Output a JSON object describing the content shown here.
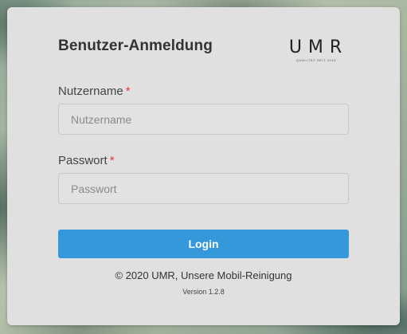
{
  "login": {
    "title": "Benutzer-Anmeldung",
    "logo": {
      "text": "UMR",
      "tagline": "QUALITÄT SEIT 2010"
    },
    "username": {
      "label": "Nutzername",
      "required_marker": "*",
      "placeholder": "Nutzername",
      "value": ""
    },
    "password": {
      "label": "Passwort",
      "required_marker": "*",
      "placeholder": "Passwort",
      "value": ""
    },
    "submit_label": "Login",
    "copyright": "© 2020 UMR, Unsere Mobil-Reinigung",
    "version": "Version 1.2.8"
  },
  "colors": {
    "accent": "#3498db",
    "required": "#e53935",
    "card_background": "#e0e0e0"
  }
}
